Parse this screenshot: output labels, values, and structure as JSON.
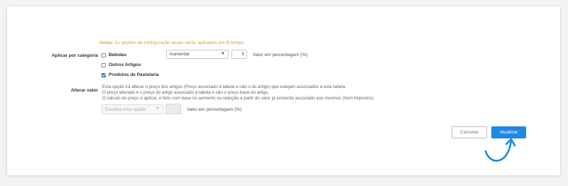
{
  "warning": {
    "prefix": "Aviso:",
    "text_before": " As opções de configuração atuais serão aplicados em ",
    "count": "3",
    "text_after": " Artigos"
  },
  "category": {
    "label": "Aplicar por categoria",
    "items": [
      {
        "label": "Bebidas",
        "checked": false
      },
      {
        "label": "Outros Artigos",
        "checked": false
      },
      {
        "label": "Produtos de Pastelaria",
        "checked": true
      }
    ],
    "action_select": "Aumentar",
    "amount": "5",
    "amount_unit": "Valor em percentagem (%)"
  },
  "alter_value": {
    "label": "Alterar valor",
    "description": [
      "Esta opção irá alterar o preço dos artigos (Preço associado à tabela e não o do artigo) que estejam associados a esta tabela.",
      "O preço alterado é o preço do artigo associado à tabela e não o preço base do artigo.",
      "O cálculo do preço a aplicar, é feito com base no aumento ou redução a partir do valor já existente associado aos mesmos (Sem Impostos)."
    ],
    "option_placeholder": "Escolha uma opção",
    "amount": "",
    "amount_unit": "Valor em percentagem (%)"
  },
  "buttons": {
    "cancel": "Cancelar",
    "update": "Atualizar"
  },
  "colors": {
    "warning": "#e69a2e",
    "primary": "#1e88e5",
    "checkbox": "#2f6fd6"
  }
}
